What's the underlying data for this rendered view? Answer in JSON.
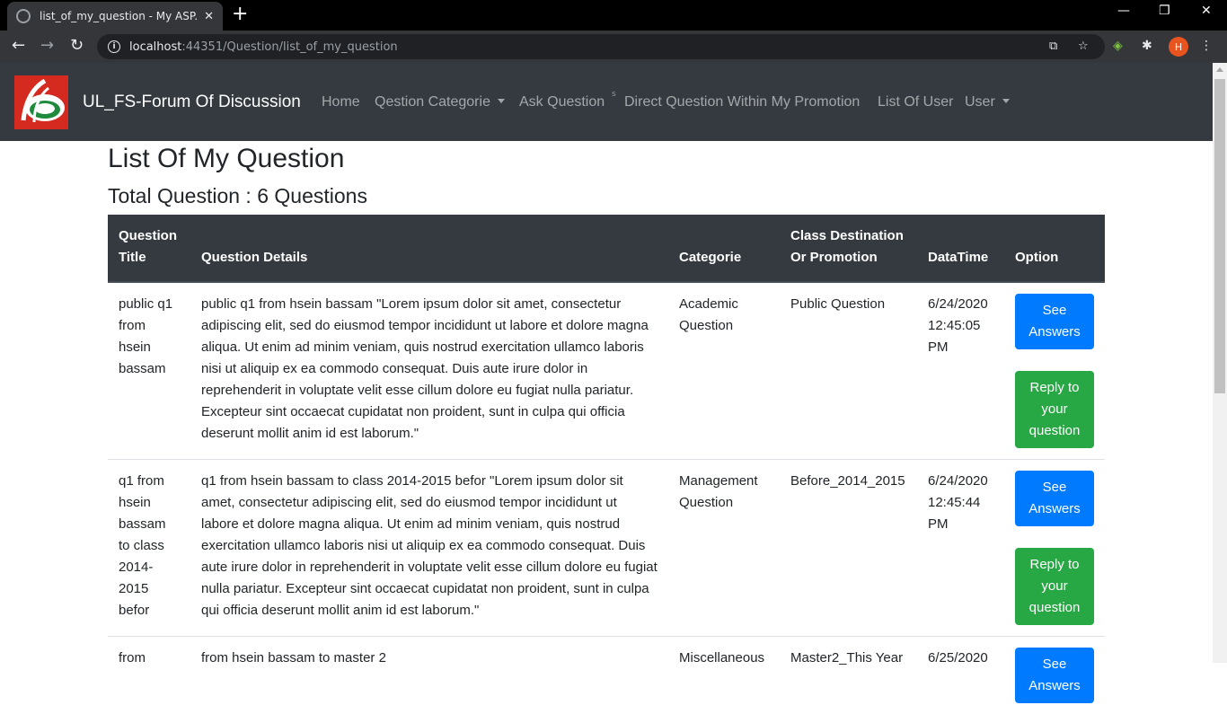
{
  "browser": {
    "tab_title": "list_of_my_question - My ASP.NE",
    "url_host": "localhost",
    "url_rest": ":44351/Question/list_of_my_question",
    "profile_initial": "H"
  },
  "navbar": {
    "brand": "UL_FS-Forum Of Discussion",
    "items": [
      {
        "label": "Home"
      },
      {
        "label": "Qestion Categorie"
      },
      {
        "label": "Ask Question"
      },
      {
        "label": "Direct Question Within My Promotion"
      },
      {
        "label": "List Of User"
      },
      {
        "label": "User"
      }
    ],
    "superscript": "s"
  },
  "page": {
    "title": "List Of My Question",
    "subtitle": "Total Question : 6 Questions"
  },
  "table": {
    "headers": {
      "title": "Question Title",
      "details": "Question Details",
      "categorie": "Categorie",
      "class": "Class Destination Or Promotion",
      "datetime": "DataTime",
      "option": "Option"
    },
    "buttons": {
      "see": "See Answers",
      "reply": "Reply to your question"
    },
    "rows": [
      {
        "title": "public q1 from hsein bassam",
        "details": "public q1 from hsein bassam \"Lorem ipsum dolor sit amet, consectetur adipiscing elit, sed do eiusmod tempor incididunt ut labore et dolore magna aliqua. Ut enim ad minim veniam, quis nostrud exercitation ullamco laboris nisi ut aliquip ex ea commodo consequat. Duis aute irure dolor in reprehenderit in voluptate velit esse cillum dolore eu fugiat nulla pariatur. Excepteur sint occaecat cupidatat non proident, sunt in culpa qui officia deserunt mollit anim id est laborum.\"",
        "categorie": "Academic Question",
        "class": "Public Question",
        "datetime": "6/24/2020 12:45:05 PM"
      },
      {
        "title": "q1 from hsein bassam to class 2014-2015 befor",
        "details": "q1 from hsein bassam to class 2014-2015 befor \"Lorem ipsum dolor sit amet, consectetur adipiscing elit, sed do eiusmod tempor incididunt ut labore et dolore magna aliqua. Ut enim ad minim veniam, quis nostrud exercitation ullamco laboris nisi ut aliquip ex ea commodo consequat. Duis aute irure dolor in reprehenderit in voluptate velit esse cillum dolore eu fugiat nulla pariatur. Excepteur sint occaecat cupidatat non proident, sunt in culpa qui officia deserunt mollit anim id est laborum.\"",
        "categorie": "Management Question",
        "class": "Before_2014_2015",
        "datetime": "6/24/2020 12:45:44 PM"
      },
      {
        "title": "from",
        "details": "from hsein bassam to master 2",
        "categorie": "Miscellaneous",
        "class": "Master2_This Year",
        "datetime": "6/25/2020"
      }
    ]
  },
  "colors": {
    "navbar_bg": "#343a40",
    "btn_primary": "#007bff",
    "btn_success": "#28a745",
    "logo_red": "#d42a1f"
  }
}
